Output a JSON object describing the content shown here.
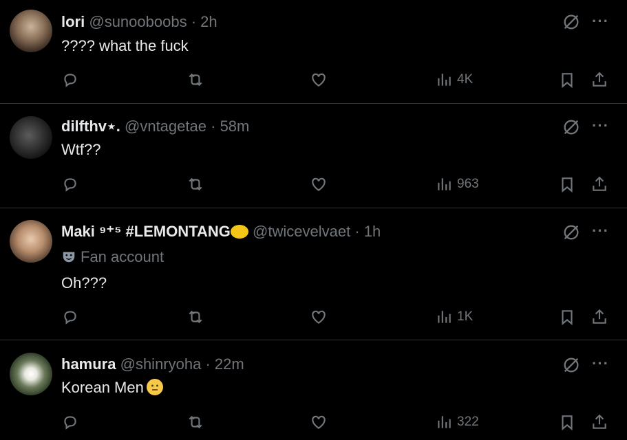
{
  "tweets": [
    {
      "name": "lori",
      "handle": "@sunooboobs",
      "sep": "·",
      "time": "2h",
      "text": "???? what the fuck",
      "views": "4K"
    },
    {
      "name": "dilfthv⋆.",
      "handle": "@vntagetae",
      "sep": "·",
      "time": "58m",
      "text": "Wtf??",
      "views": "963"
    },
    {
      "name": "Maki ⁹⁺⁵ #LEMONTANG",
      "handle": "@twicevelvaet",
      "sep": "·",
      "time": "1h",
      "label": "Fan account",
      "text": "Oh???",
      "views": "1K"
    },
    {
      "name": "hamura",
      "handle": "@shinryoha",
      "sep": "·",
      "time": "22m",
      "text": "Korean Men",
      "views": "322"
    }
  ],
  "ui": {
    "more": "···"
  },
  "colors": {
    "background": "#000000",
    "text": "#e7e9ea",
    "muted": "#71767b",
    "divider": "#2f3336"
  },
  "icons": [
    "reply-icon",
    "retweet-icon",
    "like-icon",
    "views-icon",
    "bookmark-icon",
    "share-icon",
    "grok-icon",
    "more-icon",
    "mask-icon",
    "lemon-emoji",
    "neutral-face-emoji"
  ]
}
